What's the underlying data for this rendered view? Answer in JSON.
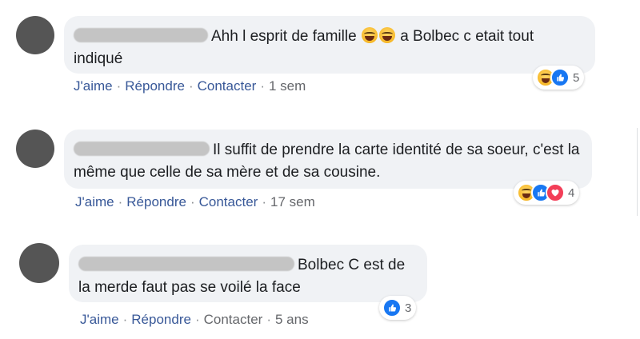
{
  "comments": [
    {
      "text": "Ahh l esprit de famille",
      "text_after_emoji": " a Bolbec c etait tout indiqué",
      "actions": {
        "like": "J'aime",
        "reply": "Répondre",
        "contact": "Contacter",
        "time": "1 sem"
      },
      "reaction_count": "5",
      "reaction_icons": [
        "haha",
        "like"
      ]
    },
    {
      "text": "Il suffit de prendre la carte identité de sa soeur, c'est la même que celle de sa mère et de sa cousine.",
      "actions": {
        "like": "J'aime",
        "reply": "Répondre",
        "contact": "Contacter",
        "time": "17 sem"
      },
      "reaction_count": "4",
      "reaction_icons": [
        "haha",
        "like",
        "love"
      ]
    },
    {
      "text": "Bolbec C est de la merde faut pas se voilé la face",
      "actions": {
        "like": "J'aime",
        "reply": "Répondre",
        "contact": "Contacter",
        "time": "5 ans"
      },
      "reaction_count": "3",
      "reaction_icons": [
        "like"
      ]
    }
  ],
  "separator": "·",
  "colors": {
    "bubble": "#f0f2f5",
    "link": "#385898",
    "muted": "#65676b",
    "like_blue": "#1877f2",
    "love_red": "#f33e58",
    "haha_yellow": "#f7b928"
  }
}
